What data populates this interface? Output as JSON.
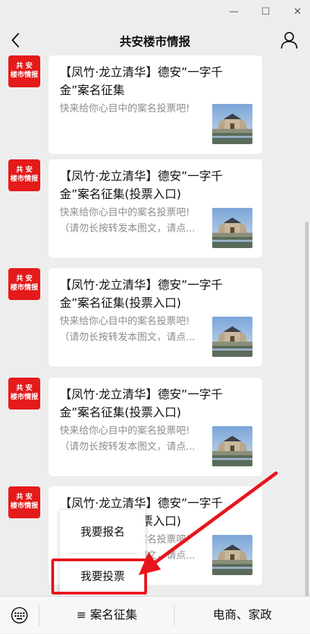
{
  "window": {
    "minimize_glyph": "—",
    "maximize_glyph": "☐",
    "close_glyph": "✕"
  },
  "nav": {
    "title": "共安楼市情报",
    "back_icon": "chevron-left-icon",
    "profile_icon": "user-icon"
  },
  "avatar": {
    "line1": "共 安",
    "line2": "楼市情报"
  },
  "messages": [
    {
      "title": "【凤竹·龙立清华】德安”一字千金”案名征集",
      "desc": "快来给你心目中的案名投票吧!"
    },
    {
      "title": "【凤竹·龙立清华】德安”一字千金”案名征集(投票入口)",
      "desc": "快来给你心目中的案名投票吧!\n（请勿长按转发本图文，请点..."
    },
    {
      "title": "【凤竹·龙立清华】德安”一字千金”案名征集(投票入口)",
      "desc": "快来给你心目中的案名投票吧!\n（请勿长按转发本图文，请点..."
    },
    {
      "title": "【凤竹·龙立清华】德安”一字千金”案名征集(投票入口)",
      "desc": "快来给你心目中的案名投票吧!\n（请勿长按转发本图文，请点..."
    },
    {
      "title": "【凤竹·龙立清华】德安”一字千金”案名征集(投票入口)",
      "desc": "快来给你心目中的案名投票吧!\n（请勿长按转发本图文，请点..."
    }
  ],
  "popup": {
    "items": [
      {
        "label": "我要报名"
      },
      {
        "label": "我要投票"
      }
    ]
  },
  "bottom": {
    "keyboard_icon": "keyboard-icon",
    "menu1": "≡ 案名征集",
    "menu2": "电商、家政"
  },
  "colors": {
    "accent_red": "#e8141c",
    "avatar_red": "#e51a1a",
    "background": "#ededed"
  }
}
